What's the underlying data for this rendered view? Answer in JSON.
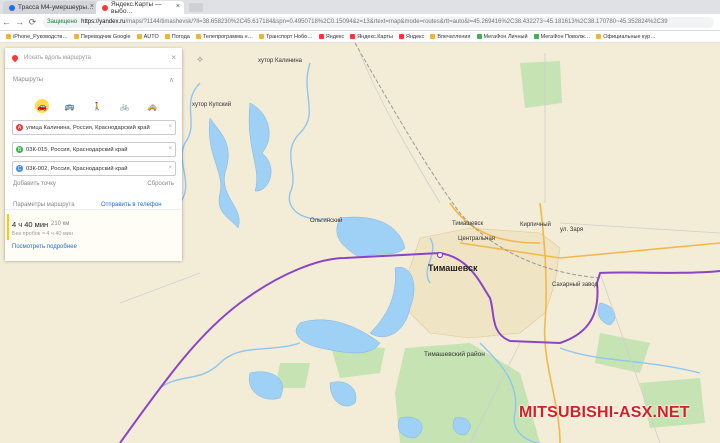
{
  "browser": {
    "tabs": [
      {
        "label": "Трасса М4-умершеуры…",
        "favicon_color": "#1a73e8"
      },
      {
        "label": "Яндекс.Карты — выбо…",
        "favicon_color": "#ff3333"
      }
    ],
    "nav": {
      "back": "←",
      "forward": "→",
      "reload": "⟳",
      "home": "⌂"
    },
    "address": {
      "secure_label": "Защищено",
      "host": "https://yandex.ru",
      "path": "/maps/?1144/timashevsk/?ll=38.658230%2C45.617184&spn=0.4950718%2C0.15094&z=13&rtext=map&mode=routes&rtt=auto&l=45.269416%2C38.432273~45.181613%2C38.170780~45.352824%2C39"
    },
    "bookmarks": [
      "iPhone_Руководств…",
      "Переводчик Google",
      "AUTO",
      "Погода",
      "Телепрограмма н…",
      "Транспорт Нобо…",
      "Яндекс",
      "Яндекс.Карты",
      "Яндекс",
      "Впечатления",
      "МегаФон Личный",
      "МегаФон Поволж…",
      "Официальные кур…"
    ]
  },
  "panel": {
    "search_placeholder": "Искать вдоль маршрута",
    "routes_header": "Маршруты",
    "modes": [
      "car",
      "bus",
      "walk",
      "bike",
      "taxi"
    ],
    "waypoints": [
      {
        "letter": "A",
        "color": "#e03a3a",
        "text": "улица Калинина, Россия, Краснодарский край"
      },
      {
        "letter": "B",
        "color": "#3cb44b",
        "text": "03К-015, Россия, Краснодарский край"
      },
      {
        "letter": "C",
        "color": "#3d8fe0",
        "text": "03К-002, Россия, Краснодарский край"
      }
    ],
    "add_point": "Добавить точку",
    "reset": "Сбросить",
    "avoid_label": "Параметры маршрута",
    "send_to_phone": "Отправить в телефон",
    "route": {
      "time": "4 ч 40 мин",
      "distance": "210 км",
      "alt": "Без пробок ≈ 4 ч 40 мин",
      "more": "Посмотреть подробнее"
    }
  },
  "map_labels": {
    "city": "Тимашевск",
    "district": "Тимашевский район",
    "khutor_kalinin": "хутор Калинина",
    "khutor_kupsky": "хутор Купский",
    "olginsky": "Ольгинский",
    "kirpich": "Кирпичный",
    "timashevsk_small": "Тимашевск",
    "sugar": "Сахарный завод",
    "tsentralnaya": "Центральная",
    "zarya": "ул. Заря"
  },
  "watermark": "MITSUBISHI-ASX.NET",
  "colors": {
    "route": "#8b44c4",
    "water": "#9fd0f5",
    "land": "#f3ecd7",
    "green": "#c5e3b3",
    "accent": "#ffdb4d"
  }
}
